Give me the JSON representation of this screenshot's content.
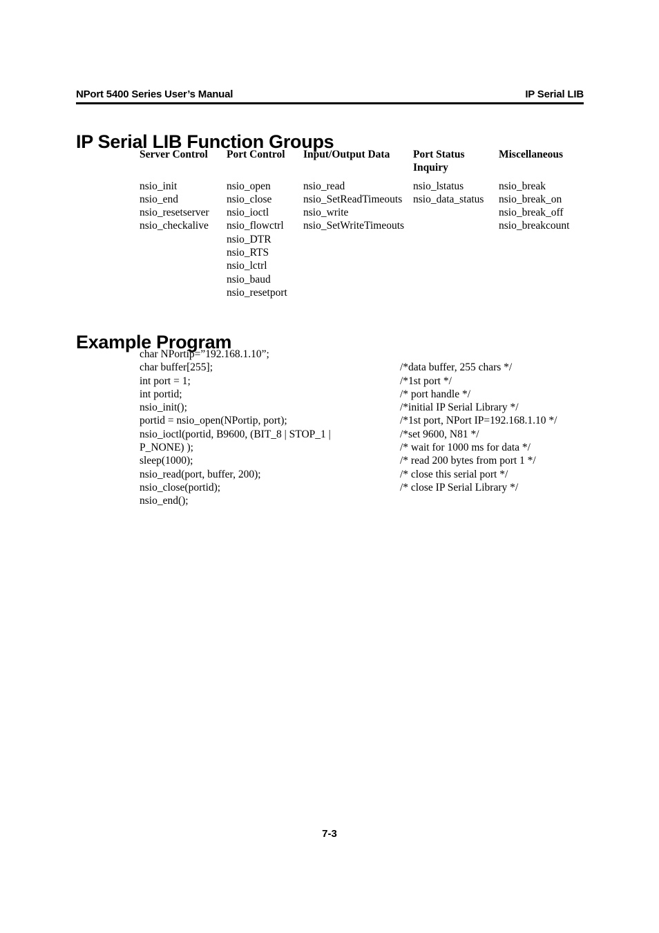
{
  "header": {
    "left": "NPort 5400 Series User’s Manual",
    "right": "IP Serial LIB"
  },
  "sections": {
    "function_groups_title": "IP Serial LIB Function Groups",
    "example_program_title": "Example Program"
  },
  "function_groups": {
    "columns": [
      {
        "header_line1": "Server Control",
        "header_line2": "",
        "items": [
          "nsio_init",
          "nsio_end",
          "nsio_resetserver",
          "nsio_checkalive"
        ]
      },
      {
        "header_line1": "Port Control",
        "header_line2": "",
        "items": [
          "nsio_open",
          "nsio_close",
          "nsio_ioctl",
          "nsio_flowctrl",
          "nsio_DTR",
          "nsio_RTS",
          "nsio_lctrl",
          "nsio_baud",
          "nsio_resetport"
        ]
      },
      {
        "header_line1": "Input/Output Data",
        "header_line2": "",
        "items": [
          "nsio_read",
          "nsio_SetReadTimeouts",
          "nsio_write",
          "nsio_SetWriteTimeouts"
        ]
      },
      {
        "header_line1": "Port Status",
        "header_line2": "Inquiry",
        "items": [
          "nsio_lstatus",
          "nsio_data_status"
        ]
      },
      {
        "header_line1": "Miscellaneous",
        "header_line2": "",
        "items": [
          "nsio_break",
          "nsio_break_on",
          "nsio_break_off",
          "nsio_breakcount"
        ]
      }
    ]
  },
  "example_program": {
    "lines": [
      {
        "code": "char NPortip=”192.168.1.10”;",
        "comment": ""
      },
      {
        "code": "char buffer[255];",
        "comment": "/*data buffer, 255 chars */"
      },
      {
        "code": "int port = 1;",
        "comment": "/*1st port */"
      },
      {
        "code": "int portid;",
        "comment": "/* port handle */"
      },
      {
        "code": "nsio_init();",
        "comment": "/*initial IP Serial Library */"
      },
      {
        "code": "portid = nsio_open(NPortip, port);",
        "comment": "/*1st port, NPort IP=192.168.1.10 */"
      },
      {
        "code": "nsio_ioctl(portid, B9600, (BIT_8 | STOP_1 |",
        "comment": "/*set 9600, N81 */"
      },
      {
        "code": "P_NONE) );",
        "comment": "/* wait for 1000 ms for data */"
      },
      {
        "code": "sleep(1000);",
        "comment": "/* read 200 bytes from port 1 */"
      },
      {
        "code": "nsio_read(port, buffer, 200);",
        "comment": "/* close this serial port */"
      },
      {
        "code": "nsio_close(portid);",
        "comment": "/* close IP Serial Library */"
      },
      {
        "code": "nsio_end();",
        "comment": ""
      }
    ]
  },
  "footer": {
    "page_number": "7-3"
  }
}
